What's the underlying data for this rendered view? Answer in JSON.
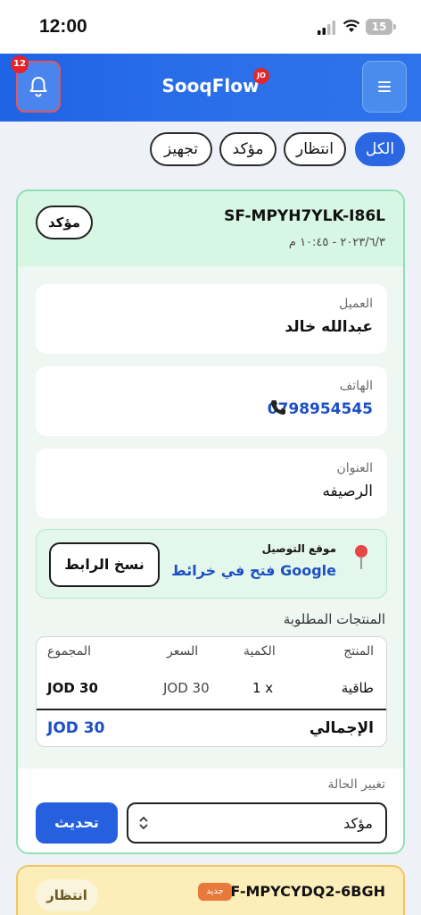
{
  "status_bar": {
    "time": "12:00",
    "battery": "15"
  },
  "header": {
    "brand": "SooqFlow",
    "brand_badge": "JO",
    "notification_count": "12",
    "colors": {
      "primary": "#2b67e3"
    }
  },
  "filters": {
    "tabs": [
      "الكل",
      "انتظار",
      "مؤكد",
      "تجهيز"
    ],
    "active": "الكل"
  },
  "order": {
    "id": "SF-MPYH7YLK-I86L",
    "date": "٢٠٢٣/٦/٣ - ١٠:٤٥ م",
    "status": "مؤكد",
    "customer": {
      "label": "العميل",
      "value": "عبدالله خالد"
    },
    "phone": {
      "label": "الهاتف",
      "value": "0798954545"
    },
    "address": {
      "label": "العنوان",
      "value": "الرصيفه"
    },
    "location": {
      "title": "موقع التوصيل",
      "link_text": "فتح في خرائط Google",
      "copy_label": "نسخ الرابط"
    },
    "products_title": "المنتجات المطلوبة",
    "table": {
      "headers": {
        "product": "المنتج",
        "qty": "الكمية",
        "price": "السعر",
        "sum": "المجموع"
      },
      "rows": [
        {
          "product": "طاقية",
          "qty": "1 x",
          "price": "JOD 30",
          "sum": "JOD 30"
        }
      ],
      "total_label": "الإجمالي",
      "total_value": "JOD 30"
    },
    "change_status": {
      "label": "تغيير الحالة",
      "selected": "مؤكد",
      "update_label": "تحديث"
    }
  },
  "next_order": {
    "id": "SF-MPYCYDQ2-6BGH",
    "badge": "جديد",
    "status": "انتظار"
  }
}
